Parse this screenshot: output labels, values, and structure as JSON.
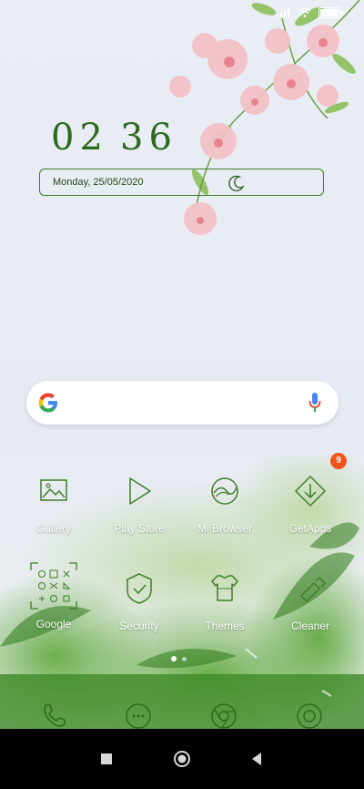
{
  "status_bar": {
    "battery_level": 0.95
  },
  "clock": {
    "hours": "02",
    "minutes": "36"
  },
  "date": {
    "text": "Monday, 25/05/2020",
    "weather_icon": "moon-icon"
  },
  "search": {
    "logo_icon": "google-logo-icon",
    "mic_icon": "mic-icon"
  },
  "apps_row1": [
    {
      "label": "Gallery",
      "icon": "gallery-icon"
    },
    {
      "label": "Play Store",
      "icon": "play-store-icon"
    },
    {
      "label": "Mi Browser",
      "icon": "mi-browser-icon"
    },
    {
      "label": "GetApps",
      "icon": "getapps-icon",
      "badge": "9"
    }
  ],
  "apps_row2": [
    {
      "label": "Google",
      "icon": "google-folder-icon"
    },
    {
      "label": "Security",
      "icon": "security-icon"
    },
    {
      "label": "Themes",
      "icon": "themes-icon"
    },
    {
      "label": "Cleaner",
      "icon": "cleaner-icon"
    }
  ],
  "page_indicator": {
    "pages": 2,
    "active": 1
  },
  "dock": [
    "phone-icon",
    "messages-icon",
    "chrome-icon",
    "camera-icon"
  ],
  "navbar": [
    "recents-button",
    "home-button",
    "back-button"
  ],
  "colors": {
    "accent_green": "#3f7d2a",
    "badge": "#f2551c",
    "nav_bg": "#000000"
  }
}
